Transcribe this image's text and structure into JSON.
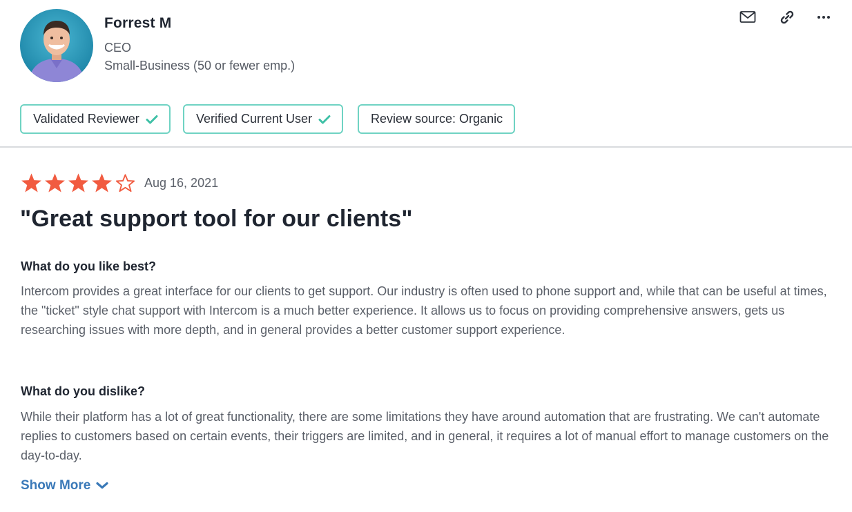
{
  "reviewer": {
    "name": "Forrest M",
    "role": "CEO",
    "company_size": "Small-Business (50 or fewer emp.)"
  },
  "actions": {
    "icons": [
      "mail-icon",
      "link-icon",
      "more-icon"
    ]
  },
  "badges": [
    {
      "label": "Validated Reviewer",
      "verified": true
    },
    {
      "label": "Verified Current User",
      "verified": true
    },
    {
      "label": "Review source: Organic",
      "verified": false
    }
  ],
  "review": {
    "rating": 4,
    "rating_max": 5,
    "date": "Aug 16, 2021",
    "title": "\"Great support tool for our clients\"",
    "questions": [
      {
        "question": "What do you like best?",
        "answer": "Intercom provides a great interface for our clients to get support. Our industry is often used to phone support and, while that can be useful at times, the \"ticket\" style chat support with Intercom is a much better experience. It allows us to focus on providing comprehensive answers, gets us researching issues with more depth, and in general provides a better customer support experience."
      },
      {
        "question": "What do you dislike?",
        "answer": "While their platform has a lot of great functionality, there are some limitations they have around automation that are frustrating. We can't automate replies to customers based on certain events, their triggers are limited, and in general, it requires a lot of manual effort to manage customers on the day-to-day."
      }
    ],
    "show_more_label": "Show More"
  },
  "colors": {
    "star": "#f15b40",
    "badge_border": "#6fd3c3",
    "check": "#3ec0a6",
    "link": "#3a79b8"
  }
}
